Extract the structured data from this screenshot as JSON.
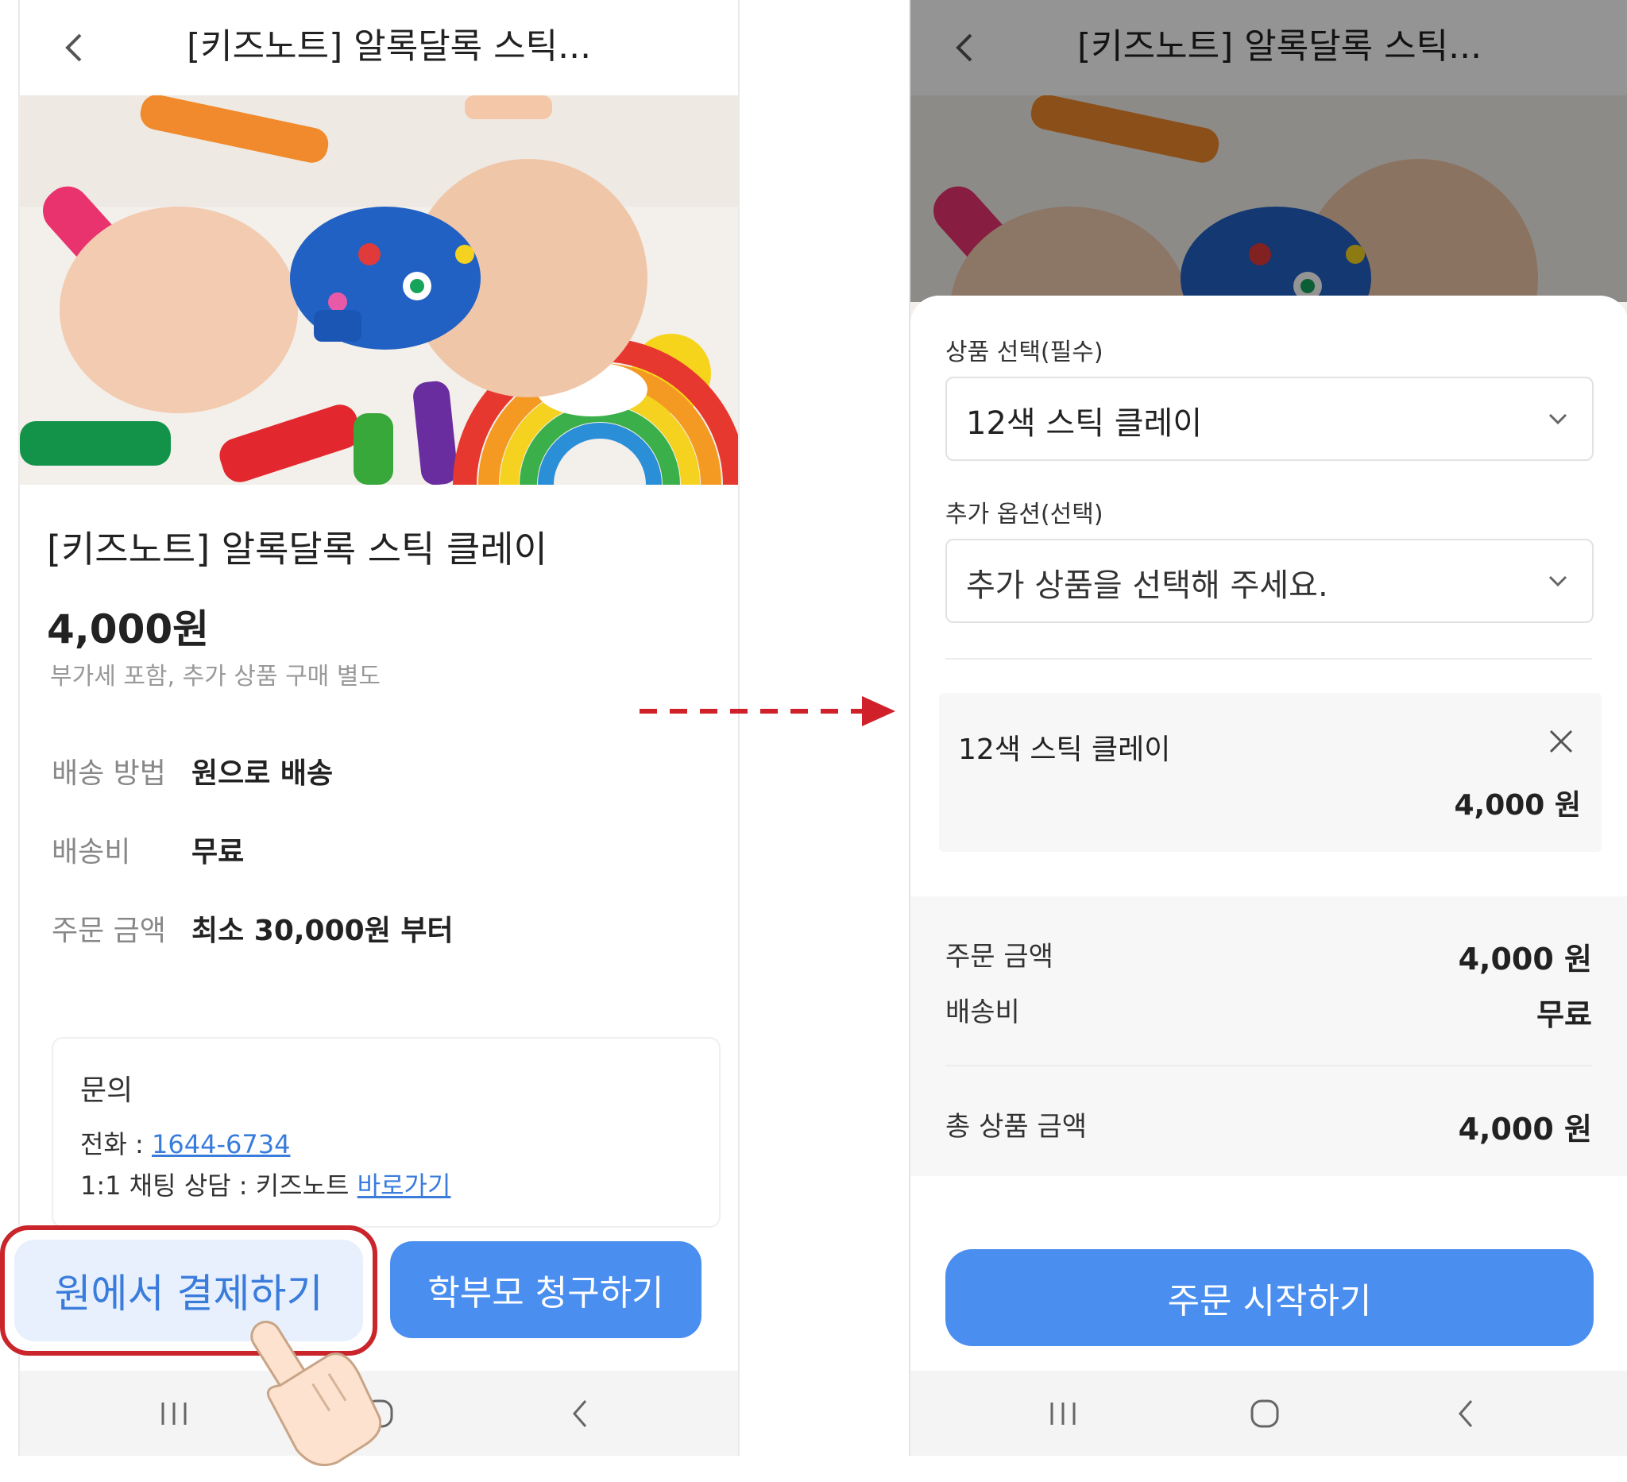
{
  "left_screen": {
    "appbar": {
      "title": "[키즈노트] 알록달록 스틱...",
      "back_icon": "chevron-left-icon"
    },
    "product": {
      "name": "[키즈노트] 알록달록 스틱 클레이",
      "price": "4,000원",
      "price_note": "부가세 포함, 추가 상품 구매 별도"
    },
    "info": [
      {
        "label": "배송 방법",
        "value": "원으로 배송"
      },
      {
        "label": "배송비",
        "value": "무료"
      },
      {
        "label": "주문 금액",
        "value": "최소 30,000원 부터"
      }
    ],
    "inquiry": {
      "title": "문의",
      "phone_label": "전화 : ",
      "phone": "1644-6734",
      "chat_label": "1:1 채팅 상담 : 키즈노트 ",
      "chat_link": "바로가기"
    },
    "buttons": {
      "pay_at_center": "원에서 결제하기",
      "bill_parent": "학부모 청구하기"
    }
  },
  "right_screen": {
    "appbar": {
      "title": "[키즈노트] 알록달록 스틱..."
    },
    "sheet": {
      "product_select_label": "상품 선택(필수)",
      "product_select_value": "12색 스틱 클레이",
      "addon_label": "추가 옵션(선택)",
      "addon_placeholder": "추가 상품을 선택해 주세요.",
      "selected_item": {
        "name": "12색 스틱 클레이",
        "amount": "4,000 원"
      },
      "summary": {
        "order_amount_label": "주문 금액",
        "order_amount": "4,000 원",
        "shipping_label": "배송비",
        "shipping": "무료",
        "total_label": "총 상품 금액",
        "total": "4,000 원"
      },
      "order_button": "주문 시작하기"
    }
  },
  "colors": {
    "accent_blue": "#4a8ef0",
    "highlight_red": "#c9252b",
    "arrow_red": "#d0202a"
  }
}
